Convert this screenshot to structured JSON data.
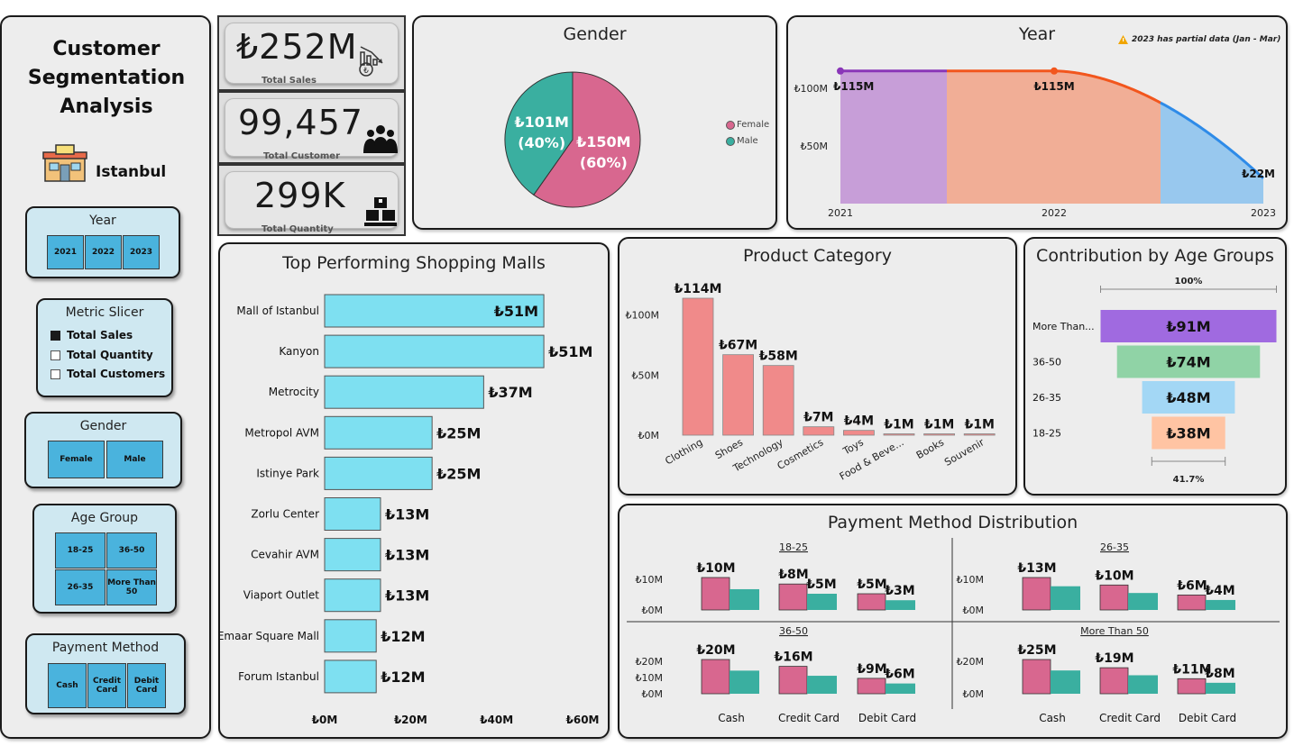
{
  "title": "Customer Segmentation Analysis",
  "city": "Istanbul",
  "slicers": {
    "year": {
      "title": "Year",
      "options": [
        "2021",
        "2022",
        "2023"
      ]
    },
    "metric": {
      "title": "Metric Slicer",
      "options": [
        "Total Sales",
        "Total Quantity",
        "Total Customers"
      ],
      "selected": "Total Sales"
    },
    "gender": {
      "title": "Gender",
      "options": [
        "Female",
        "Male"
      ]
    },
    "age_group": {
      "title": "Age Group",
      "options": [
        "18-25",
        "36-50",
        "26-35",
        "More Than 50"
      ]
    },
    "payment": {
      "title": "Payment Method",
      "options": [
        "Cash",
        "Credit Card",
        "Debit Card"
      ]
    }
  },
  "kpis": {
    "sales": {
      "value": "₺252M",
      "label": "Total Sales"
    },
    "customer": {
      "value": "99,457",
      "label": "Total Customer"
    },
    "quantity": {
      "value": "299K",
      "label": "Total Quantity"
    }
  },
  "colors": {
    "female": "#d8678f",
    "male": "#3aafa0",
    "mall_bar": "#7ee0f1",
    "category_bar": "#f08a8a",
    "age_more50": "#a06ae0",
    "age_36_50": "#90d3a6",
    "age_26_35": "#a3d7f5",
    "age_18_25": "#ffc4a3"
  },
  "chart_data": [
    {
      "id": "gender",
      "type": "pie",
      "title": "Gender",
      "slices": [
        {
          "name": "Female",
          "value": 150,
          "label": "₺150M",
          "pct": "(60%)"
        },
        {
          "name": "Male",
          "value": 101,
          "label": "₺101M",
          "pct": "(40%)"
        }
      ],
      "legend": "right"
    },
    {
      "id": "year",
      "type": "area",
      "title": "Year",
      "note": "2023 has partial data (Jan - Mar)",
      "x": [
        "2021",
        "2022",
        "2023"
      ],
      "values": [
        115,
        115,
        22
      ],
      "labels": [
        "₺115M",
        "₺115M",
        "₺22M"
      ],
      "yticks": [
        "₺100M",
        "₺50M"
      ],
      "ylim": [
        0,
        125
      ]
    },
    {
      "id": "malls",
      "type": "bar",
      "title": "Top Performing Shopping Malls",
      "categories": [
        "Mall of Istanbul",
        "Kanyon",
        "Metrocity",
        "Metropol AVM",
        "Istinye Park",
        "Zorlu Center",
        "Cevahir AVM",
        "Viaport Outlet",
        "Emaar Square Mall",
        "Forum Istanbul"
      ],
      "values": [
        51,
        51,
        37,
        25,
        25,
        13,
        13,
        13,
        12,
        12
      ],
      "labels": [
        "₺51M",
        "₺51M",
        "₺37M",
        "₺25M",
        "₺25M",
        "₺13M",
        "₺13M",
        "₺13M",
        "₺12M",
        "₺12M"
      ],
      "xticks": [
        "₺0M",
        "₺20M",
        "₺40M",
        "₺60M"
      ],
      "xlim": [
        0,
        60
      ]
    },
    {
      "id": "category",
      "type": "bar",
      "title": "Product Category",
      "categories": [
        "Clothing",
        "Shoes",
        "Technology",
        "Cosmetics",
        "Toys",
        "Food & Beve...",
        "Books",
        "Souvenir"
      ],
      "values": [
        114,
        67,
        58,
        7,
        4,
        1,
        1,
        1
      ],
      "labels": [
        "₺114M",
        "₺67M",
        "₺58M",
        "₺7M",
        "₺4M",
        "₺1M",
        "₺1M",
        "₺1M"
      ],
      "yticks": [
        "₺100M",
        "₺50M",
        "₺0M"
      ],
      "ylim": [
        0,
        114
      ]
    },
    {
      "id": "age",
      "type": "bar",
      "title": "Contribution by Age Groups",
      "categories": [
        "More Than...",
        "36-50",
        "26-35",
        "18-25"
      ],
      "values": [
        91,
        74,
        48,
        38
      ],
      "labels": [
        "₺91M",
        "₺74M",
        "₺48M",
        "₺38M"
      ],
      "top_pct": "100%",
      "bottom_pct": "41.7%"
    },
    {
      "id": "payment",
      "type": "bar",
      "title": "Payment Method Distribution",
      "categories": [
        "Cash",
        "Credit Card",
        "Debit Card"
      ],
      "panels": [
        {
          "name": "18-25",
          "yticks": [
            "₺10M",
            "₺0M"
          ],
          "female": [
            10,
            8,
            5
          ],
          "male": [
            6.4,
            5,
            3
          ],
          "female_labels": [
            "₺10M",
            "₺8M",
            "₺5M"
          ],
          "male_labels": [
            "",
            "₺5M",
            "₺3M"
          ],
          "ymax": 10
        },
        {
          "name": "26-35",
          "yticks": [
            "₺10M",
            "₺0M"
          ],
          "female": [
            13,
            10,
            6
          ],
          "male": [
            9.5,
            6.8,
            4
          ],
          "female_labels": [
            "₺13M",
            "₺10M",
            "₺6M"
          ],
          "male_labels": [
            "",
            "",
            "₺4M"
          ],
          "ymax": 13
        },
        {
          "name": "36-50",
          "yticks": [
            "₺20M",
            "₺10M",
            "₺0M"
          ],
          "female": [
            20,
            16,
            9
          ],
          "male": [
            13.5,
            10.5,
            6
          ],
          "female_labels": [
            "₺20M",
            "₺16M",
            "₺9M"
          ],
          "male_labels": [
            "",
            "",
            "₺6M"
          ],
          "ymax": 20
        },
        {
          "name": "More Than 50",
          "yticks": [
            "₺20M",
            "₺0M"
          ],
          "female": [
            25,
            19,
            11
          ],
          "male": [
            17,
            13.5,
            8
          ],
          "female_labels": [
            "₺25M",
            "₺19M",
            "₺11M"
          ],
          "male_labels": [
            "",
            "",
            "₺8M"
          ],
          "ymax": 25
        }
      ]
    }
  ]
}
